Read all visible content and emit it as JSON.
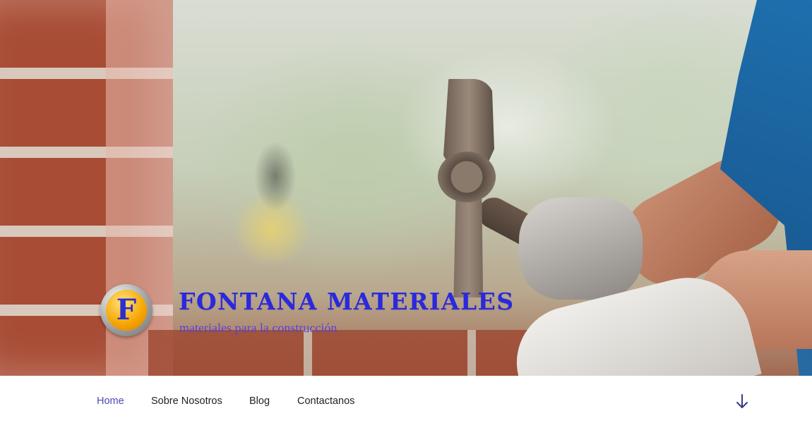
{
  "site": {
    "title": "FONTANA MATERIALES",
    "tagline": "materiales para la construcción",
    "logo_letter": "F"
  },
  "nav": {
    "items": [
      {
        "label": "Home",
        "active": true
      },
      {
        "label": "Sobre Nosotros",
        "active": false
      },
      {
        "label": "Blog",
        "active": false
      },
      {
        "label": "Contactanos",
        "active": false
      }
    ],
    "scroll_icon": "arrow-down-icon"
  },
  "colors": {
    "title": "#2b28e0",
    "tagline": "#5b3fd6",
    "nav_active": "#4a4ab0",
    "nav_text": "#222222",
    "logo_orange": "#f5a400",
    "logo_letter": "#2a2fd0"
  }
}
